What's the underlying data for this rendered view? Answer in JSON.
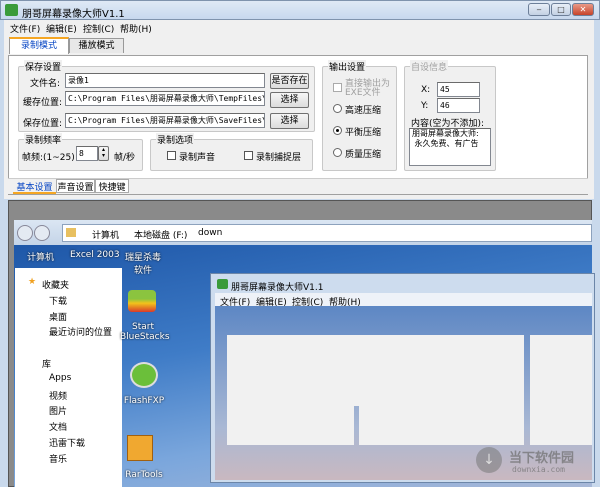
{
  "window": {
    "title": "朋哥屏幕录像大师V1.1",
    "min": "‒",
    "max": "□",
    "close": "✕"
  },
  "menu": [
    "文件(F)",
    "编辑(E)",
    "控制(C)",
    "帮助(H)"
  ],
  "tabs": [
    "录制模式",
    "播放模式"
  ],
  "save": {
    "title": "保存设置",
    "filename_label": "文件名:",
    "filename": "录像1",
    "exists_btn": "是否存在",
    "cache_label": "缓存位置:",
    "cache_path": "C:\\Program Files\\朋哥屏幕录像大师\\TempFiles\\",
    "save_label": "保存位置:",
    "save_path": "C:\\Program Files\\朋哥屏幕录像大师\\SaveFiles\\",
    "choose": "选择"
  },
  "rate": {
    "title": "录制频率",
    "label": "帧频:(1~25)",
    "value": "8",
    "unit": "帧/秒"
  },
  "options": {
    "title": "录制选项",
    "sound": "录制声音",
    "layer": "录制捕捉层"
  },
  "output": {
    "title": "输出设置",
    "exe": "直接输出为EXE文件",
    "fast": "高速压缩",
    "balanced": "平衡压缩",
    "quality": "质量压缩",
    "selected": "balanced"
  },
  "custom": {
    "title": "自设信息",
    "x_label": "X:",
    "x": "45",
    "y_label": "Y:",
    "y": "46",
    "content_label": "内容(空为不添加):",
    "content": "朋哥屏幕录像大师:\n 永久免费、有广告"
  },
  "bottom_tabs": [
    "基本设置",
    "声音设置",
    "快捷键"
  ],
  "preview": {
    "breadcrumb": [
      "计算机",
      "本地磁盘 (F:)",
      "down"
    ],
    "toolbar": [
      "计算机",
      "Excel 2003",
      "瑞星杀毒软件"
    ],
    "nav": [
      "收藏夹",
      "下载",
      "桌面",
      "最近访问的位置",
      "库",
      "Apps",
      "视频",
      "图片",
      "文档",
      "迅雷下载",
      "音乐"
    ],
    "desktop_icons": [
      "Start BlueStacks",
      "FlashFXP",
      "RarTools"
    ],
    "inner_title": "朋哥屏幕录像大师V1.1",
    "inner_menu": [
      "文件(F)",
      "编辑(E)",
      "控制(C)",
      "帮助(H)"
    ],
    "watermark": "当下软件园",
    "watermark_url": "downxia.com"
  }
}
